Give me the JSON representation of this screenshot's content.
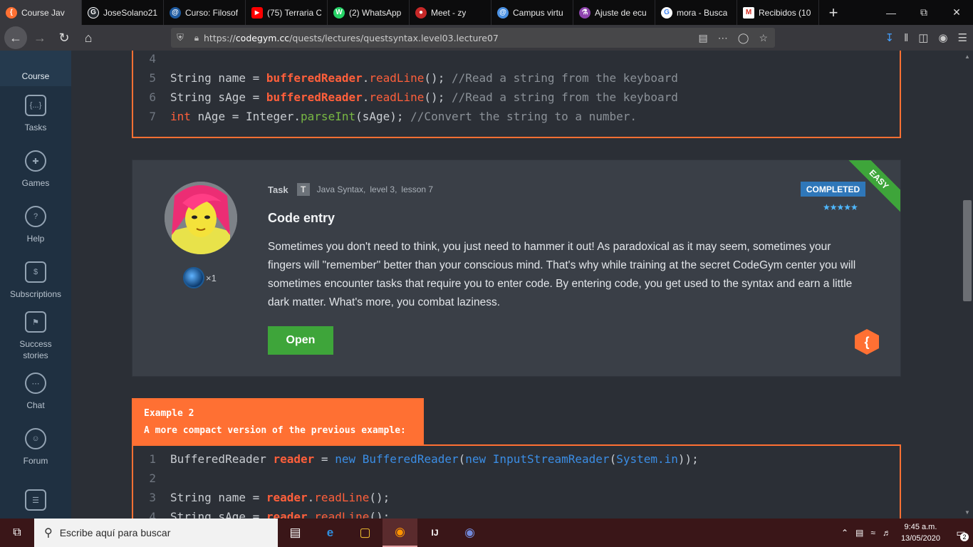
{
  "browser": {
    "tabs": [
      {
        "label": "Course Jav",
        "fav_color": "#ff7033",
        "fav_glyph": "{"
      },
      {
        "label": "JoseSolano21",
        "fav_color": "#24292e",
        "fav_glyph": "G"
      },
      {
        "label": "Curso: Filosof",
        "fav_color": "#1e5aa0",
        "fav_glyph": "@"
      },
      {
        "label": "(75) Terraria C",
        "fav_color": "#ff0000",
        "fav_glyph": "▶"
      },
      {
        "label": "(2) WhatsApp",
        "fav_color": "#25d366",
        "fav_glyph": "W"
      },
      {
        "label": "Meet - zy",
        "fav_color": "#c62828",
        "fav_glyph": "●"
      },
      {
        "label": "Campus virtu",
        "fav_color": "#4a90e2",
        "fav_glyph": "@"
      },
      {
        "label": "Ajuste de ecu",
        "fav_color": "#8e44ad",
        "fav_glyph": "⚗"
      },
      {
        "label": "mora - Busca",
        "fav_color": "#4285f4",
        "fav_glyph": "G"
      },
      {
        "label": "Recibidos (10",
        "fav_color": "#d93025",
        "fav_glyph": "M"
      }
    ],
    "url_prefix": "https://",
    "url_host": "codegym.cc",
    "url_path": "/quests/lectures/questsyntax.level03.lecture07"
  },
  "sidebar": {
    "items": [
      {
        "label": "Course",
        "icon": "course-icon"
      },
      {
        "label": "Tasks",
        "icon": "tasks-icon"
      },
      {
        "label": "Games",
        "icon": "gamepad-icon"
      },
      {
        "label": "Help",
        "icon": "help-icon"
      },
      {
        "label": "Subscriptions",
        "icon": "dollar-icon"
      },
      {
        "label": "Success stories",
        "icon": "flag-icon"
      },
      {
        "label": "Chat",
        "icon": "chat-icon"
      },
      {
        "label": "Forum",
        "icon": "forum-icon"
      }
    ]
  },
  "code1": {
    "lines": [
      {
        "n": "4",
        "text": ""
      },
      {
        "n": "5",
        "type": "str",
        "var": "name"
      },
      {
        "n": "6",
        "type": "str",
        "var": "sAge"
      },
      {
        "n": "7",
        "type": "int"
      }
    ],
    "kw_string": "String",
    "kw_eq": " = ",
    "reader": "bufferedReader",
    "dot": ".",
    "readline": "readLine",
    "parens": "();",
    "comment_read": " //Read a string from the keyboard",
    "kw_int": "int",
    "int_rest": " nAge = Integer.",
    "parseint": "parseInt",
    "parse_args": "(sAge);",
    "comment_convert": " //Convert the string to a number."
  },
  "task": {
    "label": "Task",
    "badge": "T",
    "crumb_1": "Java Syntax,",
    "crumb_2": "level 3,",
    "crumb_3": "lesson 7",
    "title": "Code entry",
    "description": "Sometimes you don't need to think, you just need to hammer it out! As paradoxical as it may seem, sometimes your fingers will \"remember\" better than your conscious mind. That's why while training at the secret CodeGym center you will sometimes encounter tasks that require you to enter code. By entering code, you get used to the syntax and earn a little dark matter. What's more, you combat laziness.",
    "open_label": "Open",
    "status": "COMPLETED",
    "stars": "★★★★★",
    "rating": 5,
    "difficulty": "EASY",
    "dark_matter": "×1",
    "hex_glyph": "{",
    "accent_green": "#3ea53a",
    "accent_blue": "#2f77b9",
    "accent_orange": "#ff7033"
  },
  "example2": {
    "title": "Example 2",
    "subtitle": "A more compact version of the previous example:"
  },
  "code2": {
    "l1": {
      "n": "1",
      "cls": "BufferedReader",
      "var": "reader",
      "eq": " = ",
      "new1": "new",
      "ctor": "BufferedReader",
      "open": "(",
      "new2": "new",
      "isr": "InputStreamReader",
      "open2": "(",
      "sysin": "System.in",
      "close": "));"
    },
    "l2": {
      "n": "2"
    },
    "l3": {
      "n": "3",
      "kw": "String",
      "rest": " name = ",
      "var": "reader",
      "dot": ".",
      "m": "readLine",
      "end": "();"
    },
    "l4": {
      "n": "4",
      "kw": "String",
      "rest": " sAge = ",
      "var": "reader",
      "dot": ".",
      "m": "readLine",
      "end": "();"
    }
  },
  "taskbar": {
    "search_placeholder": "Escribe aquí para buscar",
    "time": "9:45 a.m.",
    "date": "13/05/2020",
    "notifications": "2"
  }
}
